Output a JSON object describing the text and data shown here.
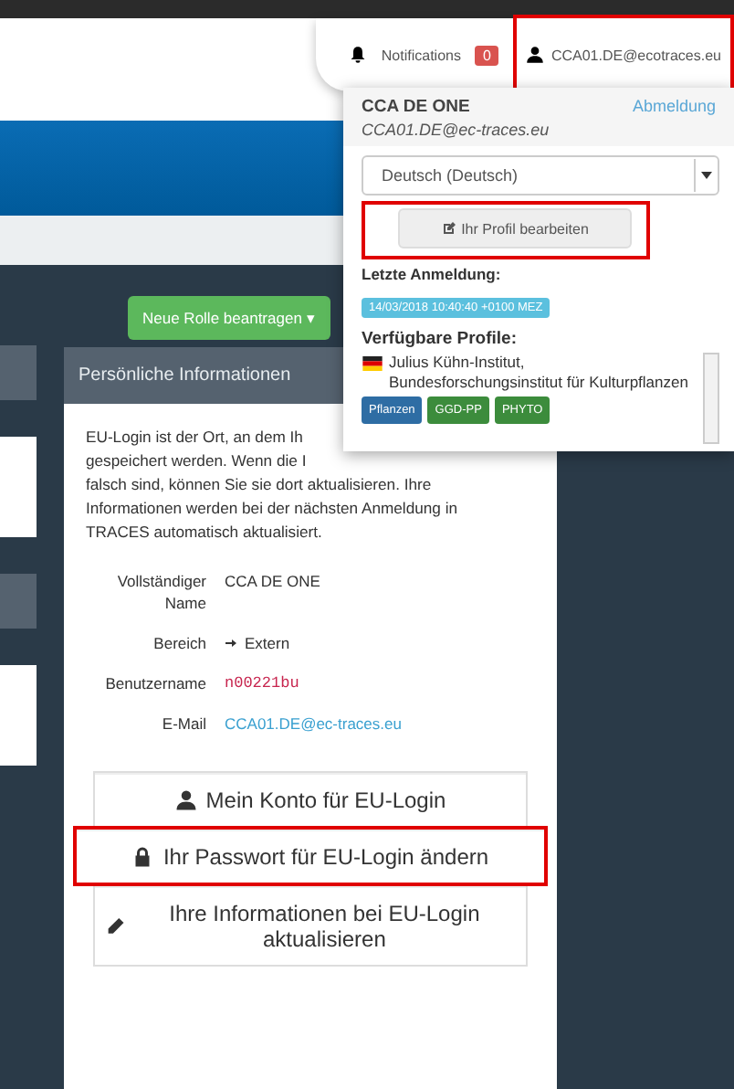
{
  "topbar": {
    "notifications": {
      "label": "Notifications",
      "count": "0"
    },
    "user": {
      "email": "CCA01.DE@ecotraces.eu",
      "highlighted": true
    }
  },
  "new_role_button": {
    "label": "Neue Rolle beantragen",
    "caret": "▾"
  },
  "panel": {
    "title": "Persönliche Informationen",
    "intro_lines": [
      "EU-Login ist der Ort, an dem Ih",
      "gespeichert werden. Wenn die I",
      "falsch sind, können Sie sie dort aktualisieren. Ihre",
      "Informationen werden bei der nächsten Anmeldung in",
      "TRACES automatisch aktualisiert."
    ],
    "fields": [
      {
        "label": "Vollständiger Name",
        "value": "CCA DE ONE",
        "kind": "plain"
      },
      {
        "label": "Bereich",
        "value": "Extern",
        "kind": "icon"
      },
      {
        "label": "Benutzername",
        "value": "n00221bu",
        "kind": "code"
      },
      {
        "label": "E-Mail",
        "value": "CCA01.DE@ec-traces.eu",
        "kind": "link"
      }
    ],
    "actions": [
      {
        "label": "Mein Konto für EU-Login",
        "kind": "user",
        "highlighted": false
      },
      {
        "label": "Ihr Passwort für EU-Login ändern",
        "kind": "lock",
        "highlighted": true
      },
      {
        "label": "Ihre Informationen bei EU-Login aktualisieren",
        "kind": "pencil",
        "highlighted": false
      }
    ]
  },
  "user_menu": {
    "name": "CCA DE ONE",
    "email": "CCA01.DE@ec-traces.eu",
    "logout": "Abmeldung",
    "language": "Deutsch (Deutsch)",
    "edit_profile": {
      "label": "Ihr Profil bearbeiten",
      "highlighted": true
    },
    "last_login_label": "Letzte Anmeldung:",
    "last_login": "14/03/2018 10:40:40 +0100 MEZ",
    "profiles_label": "Verfügbare Profile:",
    "profiles": [
      {
        "name": "Julius Kühn-Institut, Bundesforschungsinstitut für Kulturpflanzen",
        "tags": [
          {
            "label": "Pflanzen",
            "color": "#2e6da4"
          },
          {
            "label": "GGD-PP",
            "color": "#3c8c3c"
          },
          {
            "label": "PHYTO",
            "color": "#3c8c3c"
          }
        ]
      }
    ]
  }
}
